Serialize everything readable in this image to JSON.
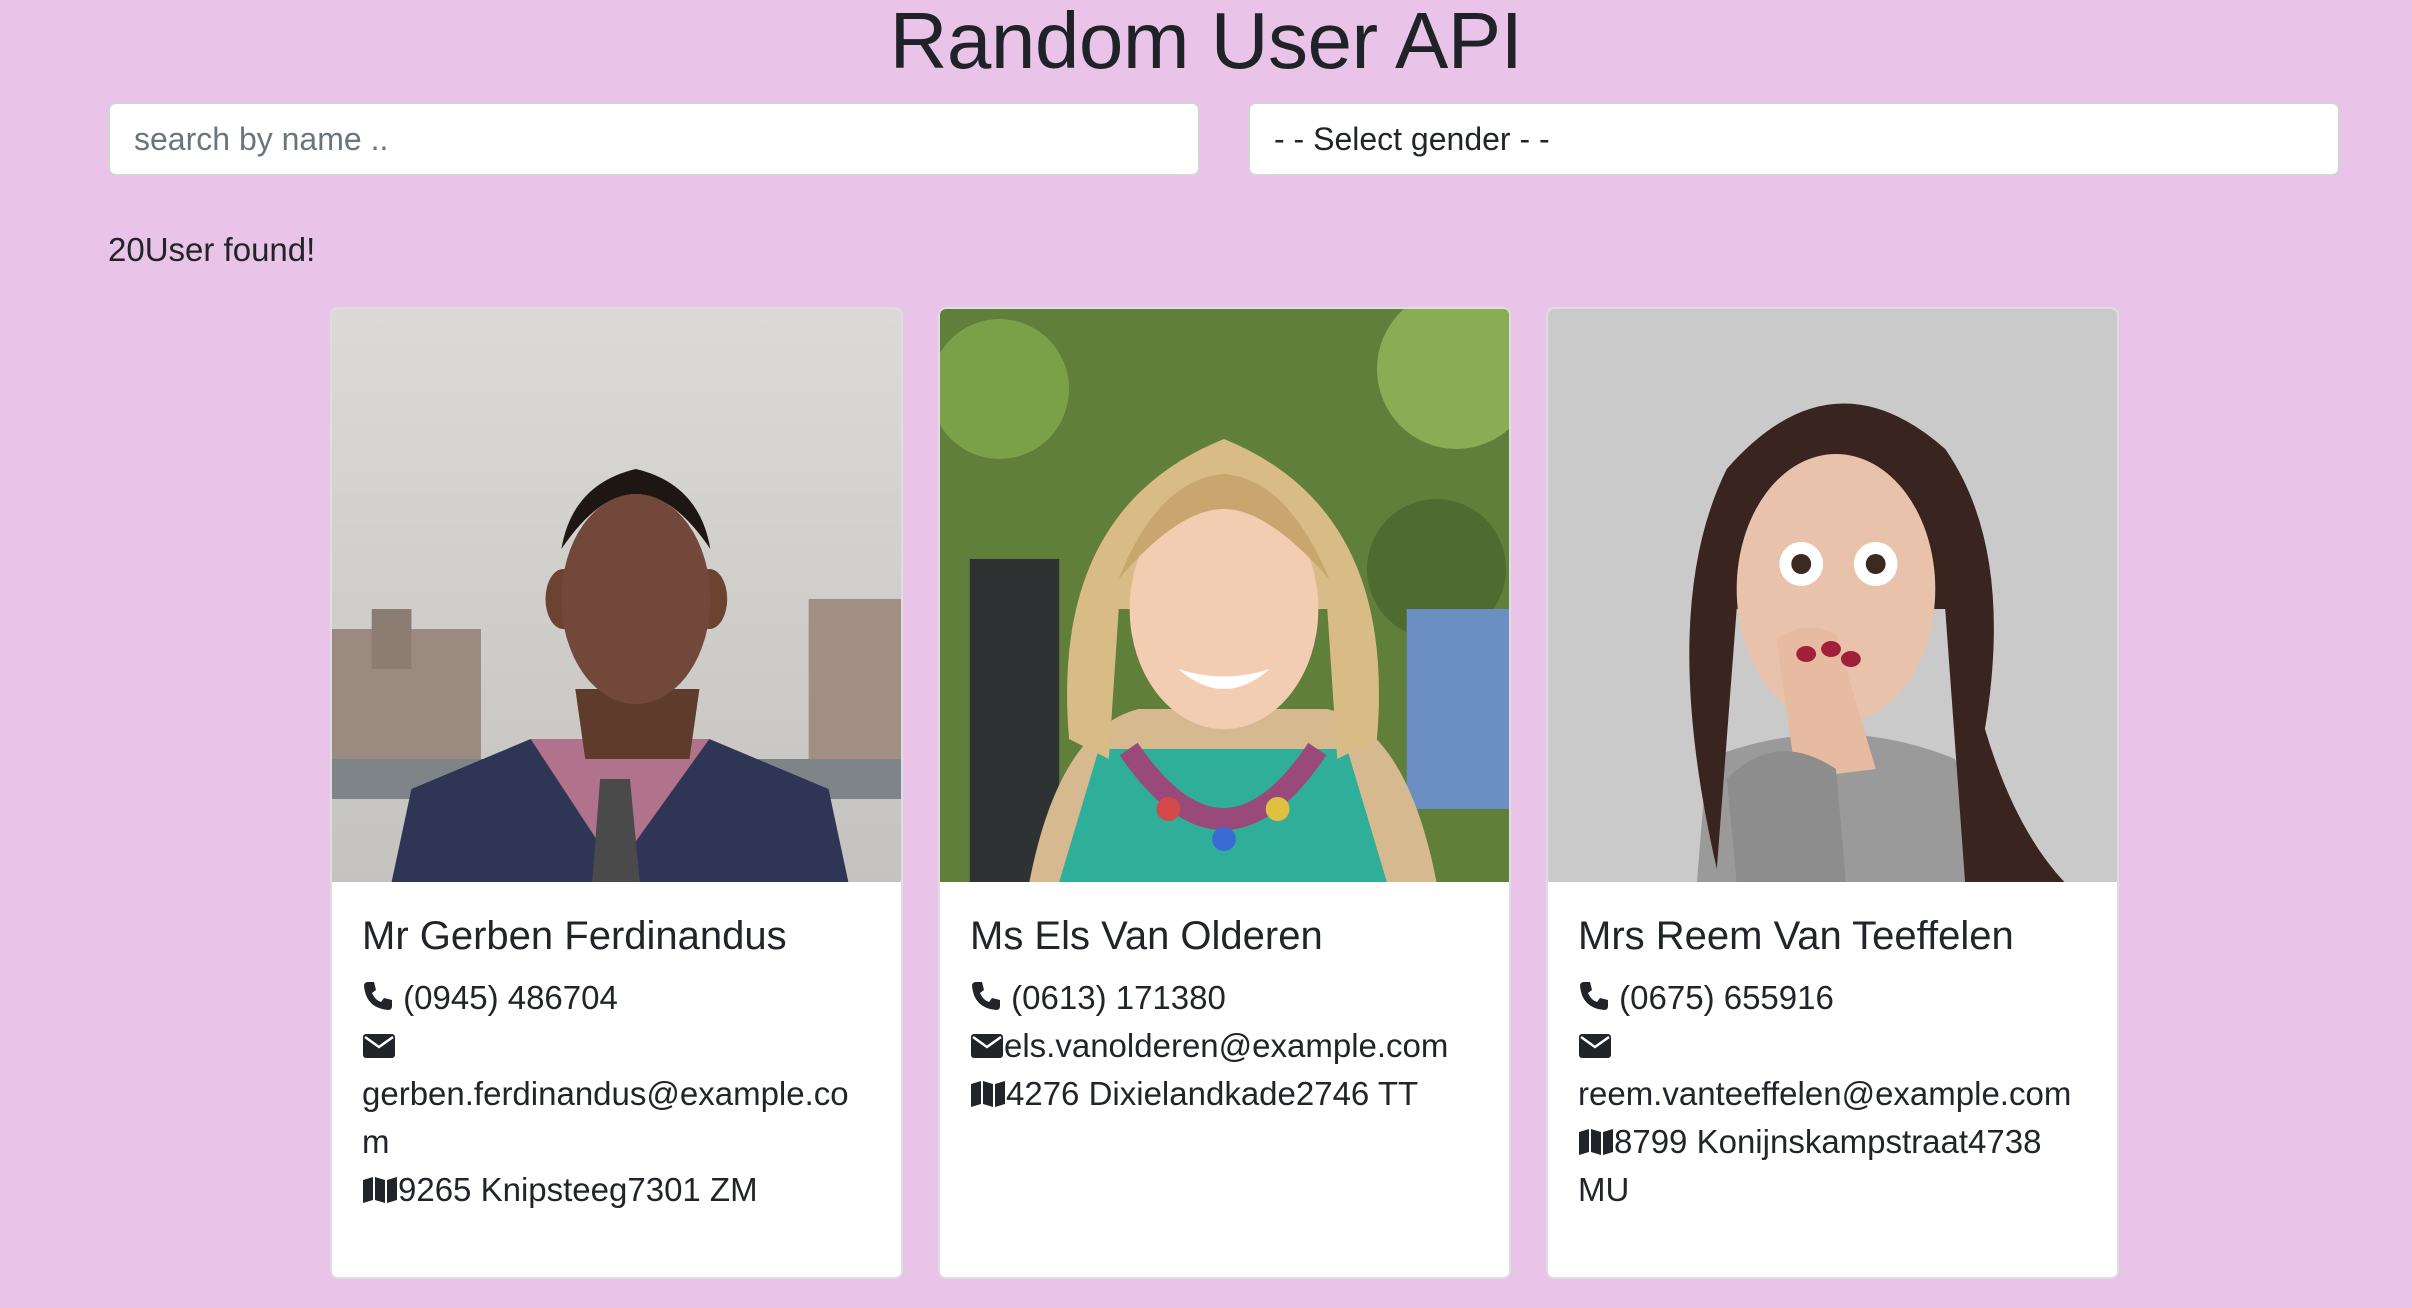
{
  "page": {
    "title": "Random User API"
  },
  "search": {
    "placeholder": "search by name .."
  },
  "gender_select": {
    "selected": "- - Select gender - -"
  },
  "result_count": "20User found!",
  "users": [
    {
      "name": "Mr Gerben Ferdinandus",
      "phone": "(0945) 486704",
      "email": "gerben.ferdinandus@example.com",
      "address": "9265 Knipsteeg7301 ZM",
      "photo": "portrait of a man in a navy suit and checked tie"
    },
    {
      "name": "Ms Els Van Olderen",
      "phone": "(0613) 171380",
      "email": "els.vanolderen@example.com",
      "address": "4276 Dixielandkade2746 TT",
      "photo": "portrait of a smiling blonde woman with a colorful necklace"
    },
    {
      "name": "Mrs Reem Van Teeffelen",
      "phone": "(0675) 655916",
      "email": "reem.vanteeffelen@example.com",
      "address": "8799 Konijnskampstraat4738 MU",
      "photo": "portrait of a surprised woman covering her mouth"
    }
  ],
  "icons": {
    "phone": "phone-icon",
    "email": "envelope-icon",
    "address": "map-icon"
  },
  "colors": {
    "background": "#e9c3e8",
    "card": "#ffffff",
    "text": "#212529"
  }
}
